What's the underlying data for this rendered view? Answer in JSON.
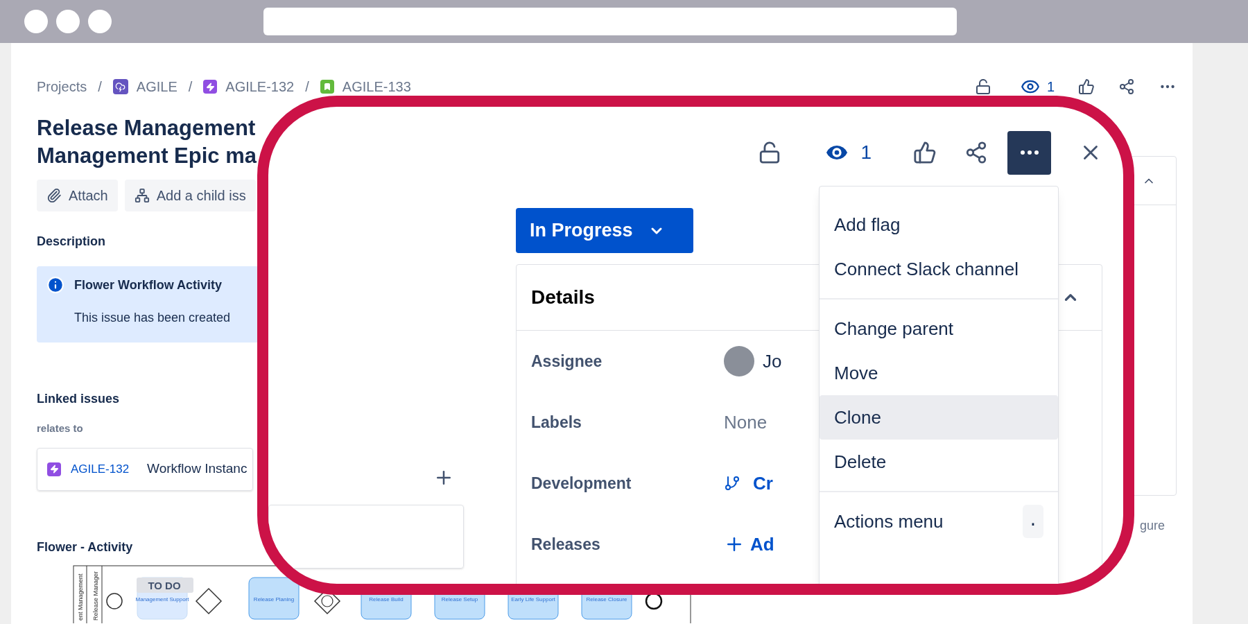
{
  "breadcrumbs": [
    {
      "label": "Projects",
      "kind": "text"
    },
    {
      "label": "/",
      "kind": "separator"
    },
    {
      "label": "AGILE",
      "kind": "project"
    },
    {
      "label": "/",
      "kind": "separator"
    },
    {
      "label": "AGILE-132",
      "kind": "epic"
    },
    {
      "label": "/",
      "kind": "separator"
    },
    {
      "label": "AGILE-133",
      "kind": "story"
    }
  ],
  "page_toolbar": {
    "watchers": "1"
  },
  "title_lines": [
    "Release Management",
    "Management Epic ma"
  ],
  "actions": [
    {
      "label": "Attach",
      "kind": "attach"
    },
    {
      "label": "Add a child iss",
      "kind": "child"
    }
  ],
  "description": {
    "heading": "Description",
    "panel_title": "Flower Workflow Activity",
    "panel_text": "This issue has been created"
  },
  "linked": {
    "heading": "Linked issues",
    "relation": "relates to",
    "issue_key": "AGILE-132",
    "issue_summary": "Workflow Instanc"
  },
  "activity": {
    "heading": "Flower - Activity",
    "lanes": [
      "ent Management",
      "Release Manager"
    ],
    "status_badge": "TO DO",
    "tasks": [
      "Management Support",
      "Release Planing",
      "Release Build",
      "Release Setup",
      "Early Life Support",
      "Release Closure"
    ]
  },
  "side_panel": {
    "footer": "gure"
  },
  "callout": {
    "toolbar": {
      "watchers": "1",
      "more_open": true
    },
    "status": "In Progress",
    "details": {
      "title": "Details",
      "expanded": true,
      "rows": [
        {
          "label": "Assignee",
          "kind": "user",
          "value": "Jo"
        },
        {
          "label": "Labels",
          "kind": "empty",
          "value": "None"
        },
        {
          "label": "Development",
          "kind": "branch",
          "value": "Cr"
        },
        {
          "label": "Releases",
          "kind": "add",
          "value": "Ad"
        }
      ]
    },
    "menu": {
      "groups": [
        [
          {
            "label": "Add flag",
            "selected": false
          },
          {
            "label": "Connect Slack channel",
            "selected": false
          }
        ],
        [
          {
            "label": "Change parent",
            "selected": false
          },
          {
            "label": "Move",
            "selected": false
          },
          {
            "label": "Clone",
            "selected": true
          },
          {
            "label": "Delete",
            "selected": false
          }
        ],
        [
          {
            "label": "Actions menu",
            "shortcut": ".",
            "selected": false
          }
        ]
      ]
    }
  }
}
